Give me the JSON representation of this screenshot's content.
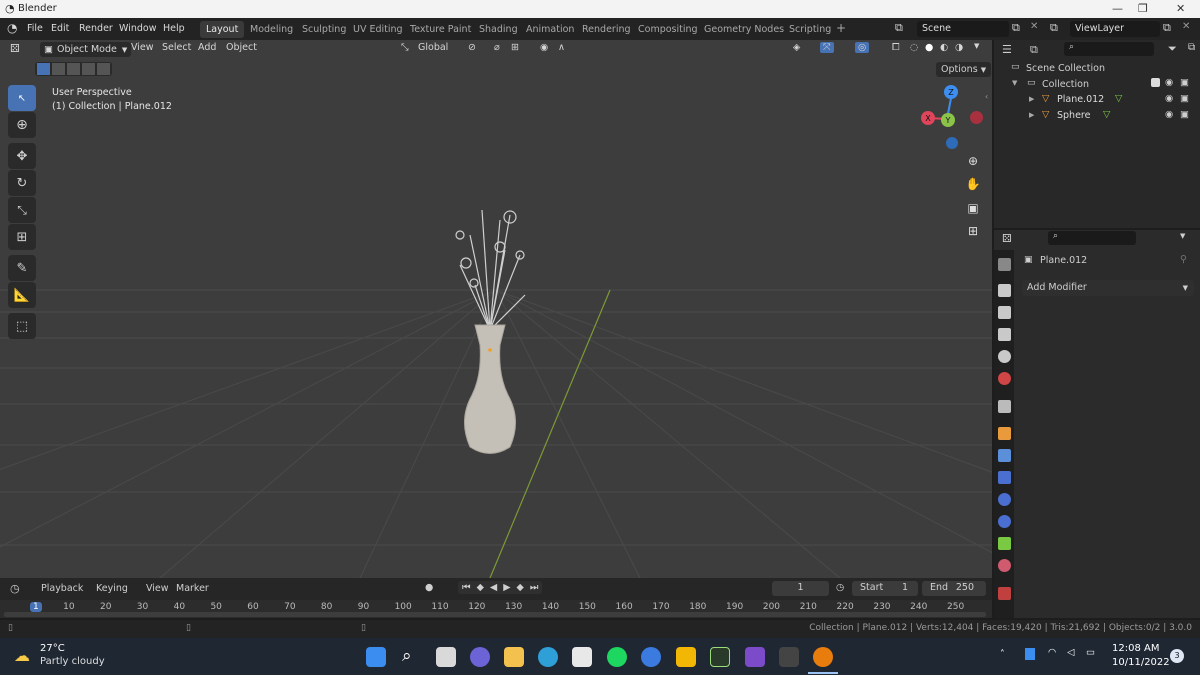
{
  "window": {
    "title": "Blender"
  },
  "menu": {
    "file": "File",
    "edit": "Edit",
    "render": "Render",
    "window": "Window",
    "help": "Help"
  },
  "workspaces": [
    "Layout",
    "Modeling",
    "Sculpting",
    "UV Editing",
    "Texture Paint",
    "Shading",
    "Animation",
    "Rendering",
    "Compositing",
    "Geometry Nodes",
    "Scripting"
  ],
  "scene": "Scene",
  "view_layer": "ViewLayer",
  "viewport": {
    "mode": "Object Mode",
    "view": "View",
    "select": "Select",
    "add": "Add",
    "object": "Object",
    "orientation": "Global",
    "options": "Options",
    "perspective": "User Perspective",
    "collection_info": "(1) Collection | Plane.012",
    "gizmo": {
      "z": "Z",
      "y": "Y",
      "x": "X"
    }
  },
  "outliner": {
    "scene_collection": "Scene Collection",
    "collection": "Collection",
    "items": [
      "Plane.012",
      "Sphere"
    ]
  },
  "properties": {
    "object_name": "Plane.012",
    "add_modifier": "Add Modifier"
  },
  "timeline": {
    "playback": "Playback",
    "keying": "Keying",
    "view": "View",
    "marker": "Marker",
    "current_frame": "1",
    "start_label": "Start",
    "start": "1",
    "end_label": "End",
    "end": "250",
    "ticks": [
      "1",
      "10",
      "20",
      "30",
      "40",
      "50",
      "60",
      "70",
      "80",
      "90",
      "100",
      "110",
      "120",
      "130",
      "140",
      "150",
      "160",
      "170",
      "180",
      "190",
      "200",
      "210",
      "220",
      "230",
      "240",
      "250"
    ]
  },
  "status": {
    "text": "Collection | Plane.012 | Verts:12,404 | Faces:19,420 | Tris:21,692 | Objects:0/2 | 3.0.0"
  },
  "taskbar": {
    "temp": "27°C",
    "weather": "Partly cloudy",
    "time": "12:08 AM",
    "date": "10/11/2022",
    "notifications": "3"
  },
  "colors": {
    "accent": "#4772b3",
    "viewport_bg": "#3d3d3d",
    "axis_x": "#e0455b",
    "axis_y": "#8bc34a",
    "axis_z": "#3c8ef0"
  }
}
